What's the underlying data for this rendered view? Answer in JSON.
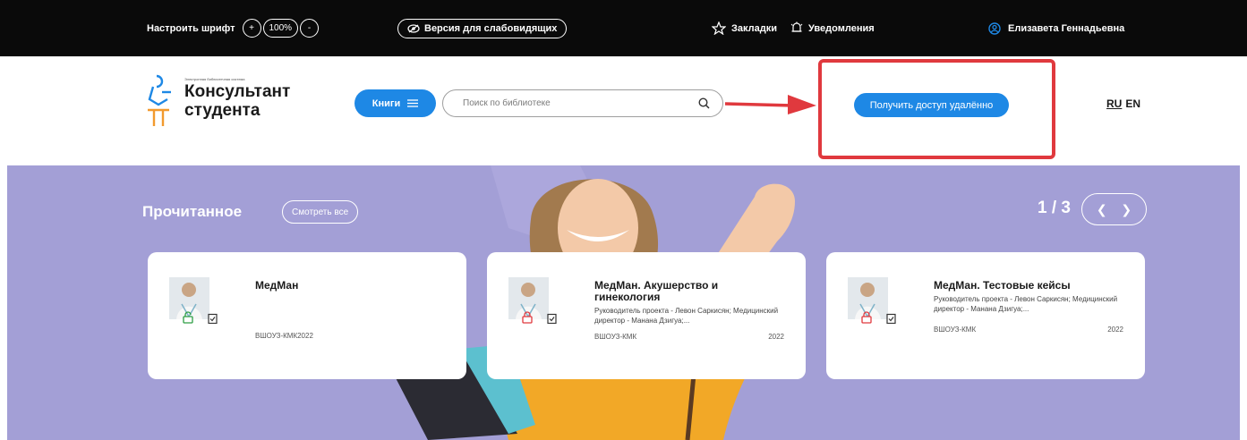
{
  "topbar": {
    "font_label": "Настроить шрифт",
    "font_increase": "+",
    "font_size": "100%",
    "font_decrease": "-",
    "low_vision": "Версия для слабовидящих",
    "bookmarks": "Закладки",
    "notifications": "Уведомления",
    "user_name": "Елизавета Геннадьевна"
  },
  "header": {
    "logo_small": "Электронная библиотечная система",
    "logo_line1": "Консультант",
    "logo_line2": "студента",
    "books_label": "Книги",
    "search_placeholder": "Поиск по библиотеке",
    "remote_access": "Получить доступ удалённо",
    "lang_ru": "RU",
    "lang_en": "EN"
  },
  "hero": {
    "section_title": "Прочитанное",
    "see_all": "Смотреть все",
    "pager": "1 / 3"
  },
  "cards": [
    {
      "title": "МедМан",
      "desc": "",
      "publisher": "ВШОУЗ-КМК2022",
      "year": "",
      "lock_color": "#2e9e44"
    },
    {
      "title": "МедМан. Акушерство и гинекология",
      "desc": "Руководитель проекта - Левон Саркисян; Медицинский директор - Манана Дзигуа;...",
      "publisher": "ВШОУЗ-КМК",
      "year": "2022",
      "lock_color": "#e0393e"
    },
    {
      "title": "МедМан. Тестовые кейсы",
      "desc": "Руководитель проекта - Левон Саркисян; Медицинский директор - Манана Дзигуа;...",
      "publisher": "ВШОУЗ-КМК",
      "year": "2022",
      "lock_color": "#e0393e"
    }
  ],
  "colors": {
    "topbar_bg": "#0a0a0a",
    "accent_blue": "#1e88e5",
    "highlight_red": "#e0393e",
    "hero_bg": "#a39fd6"
  }
}
